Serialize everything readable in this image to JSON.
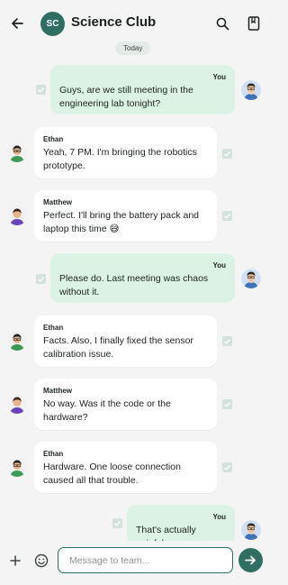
{
  "header": {
    "avatar_initials": "SC",
    "title": "Science Club",
    "back_icon": "arrow-left-icon",
    "search_icon": "search-icon",
    "book_icon": "book-icon"
  },
  "chat": {
    "date_label": "Today",
    "messages": [
      {
        "sender": "You",
        "direction": "out",
        "text": "Guys, are we still meeting in the engineering lab tonight?"
      },
      {
        "sender": "Ethan",
        "direction": "in",
        "text": "Yeah, 7 PM. I'm bringing the robotics prototype."
      },
      {
        "sender": "Matthew",
        "direction": "in",
        "text": "Perfect. I'll bring the battery pack and laptop this time 😅"
      },
      {
        "sender": "You",
        "direction": "out",
        "text": "Please do. Last meeting was chaos without it."
      },
      {
        "sender": "Ethan",
        "direction": "in",
        "text": "Facts. Also, I finally fixed the sensor calibration issue."
      },
      {
        "sender": "Matthew",
        "direction": "in",
        "text": "No way. Was it the code or the hardware?"
      },
      {
        "sender": "Ethan",
        "direction": "in",
        "text": "Hardware. One loose connection caused all that trouble."
      },
      {
        "sender": "You",
        "direction": "out",
        "text": "That's actually painful."
      }
    ]
  },
  "composer": {
    "placeholder": "Message to team...",
    "value": ""
  },
  "colors": {
    "accent": "#2f6f62",
    "outgoing_bubble": "#dcf2e4",
    "incoming_bubble": "#ffffff",
    "background": "#f3f4f3"
  }
}
